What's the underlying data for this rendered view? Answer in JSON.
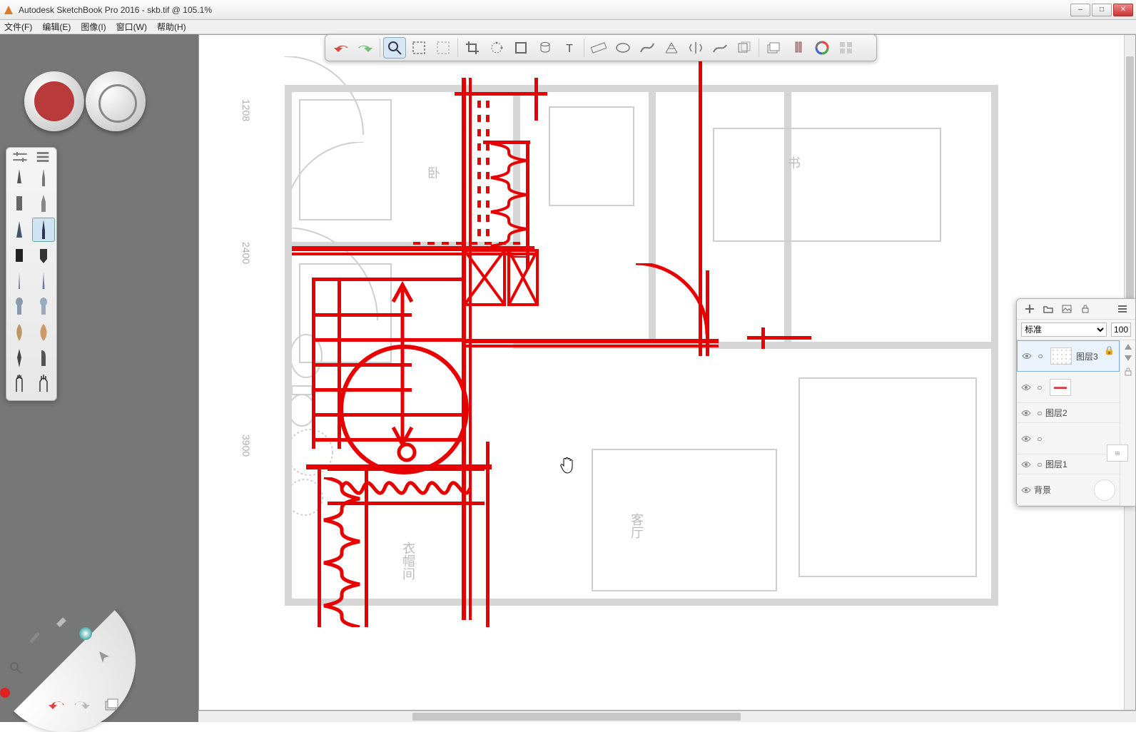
{
  "title": "Autodesk SketchBook Pro 2016 - skb.tif @ 105.1%",
  "menu": {
    "file": "文件(F)",
    "edit": "编辑(E)",
    "image": "图像(I)",
    "window": "窗口(W)",
    "help": "帮助(H)"
  },
  "toolbar": {
    "undo": "undo",
    "redo": "redo",
    "zoom": "zoom",
    "marquee": "marquee",
    "lasso": "lasso",
    "crop": "crop",
    "transform": "transform",
    "shape": "shape",
    "bucket": "bucket",
    "text": "text",
    "ruler": "ruler",
    "ellipse": "ellipse",
    "curve": "curve",
    "perspective": "perspective",
    "symmetry": "symmetry",
    "line": "line",
    "layers": "layers",
    "copic": "copic",
    "brushlib": "brushlib",
    "colorwheel": "colorwheel",
    "grid": "grid"
  },
  "brush_palette": {
    "brushes": [
      "pencil",
      "tech-pen",
      "marker",
      "ballpoint",
      "chisel",
      "fine",
      "fill-square",
      "fill-taper",
      "needle",
      "needle2",
      "soft",
      "soft2",
      "smudge",
      "airbrush",
      "inking",
      "brushpen",
      "bristle",
      "fan"
    ],
    "selected_index": 5
  },
  "puck": {
    "current_color": "#b93a3a"
  },
  "layers_panel": {
    "blend_mode": "标准",
    "opacity": "100",
    "rows": [
      {
        "id": "layer3",
        "name": "图层3",
        "visible": true,
        "selected": true,
        "thumb": "dots"
      },
      {
        "id": "layer-red",
        "name": "",
        "visible": true,
        "thumb": "red"
      },
      {
        "id": "layer2",
        "name": "图层2",
        "visible": true,
        "thumb": ""
      },
      {
        "id": "layer-plan",
        "name": "",
        "visible": true,
        "thumb": "plan"
      },
      {
        "id": "layer1",
        "name": "图层1",
        "visible": true,
        "thumb": ""
      },
      {
        "id": "bg",
        "name": "背景",
        "visible": true,
        "thumb": "big"
      }
    ]
  },
  "plan": {
    "dims": {
      "d1": "1208",
      "d2": "2400",
      "d3": "3900"
    },
    "labels": {
      "master": "卧",
      "study": "书",
      "living": "客厅",
      "closet": "衣帽间"
    }
  },
  "window_controls": {
    "minimize": "–",
    "maximize": "□",
    "close": "✕"
  }
}
